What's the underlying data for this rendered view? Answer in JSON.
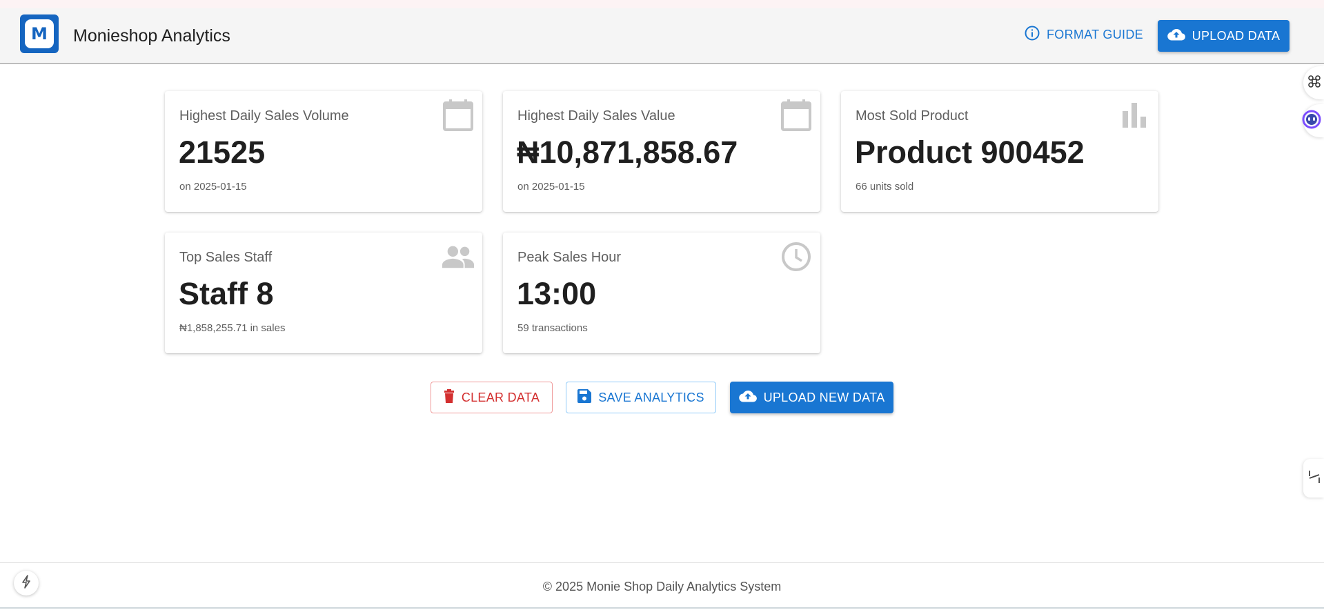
{
  "header": {
    "logo_letter": "M",
    "title": "Monieshop Analytics",
    "format_guide_label": "FORMAT GUIDE",
    "upload_label": "UPLOAD DATA"
  },
  "cards": [
    {
      "label": "Highest Daily Sales Volume",
      "value": "21525",
      "sub": "on 2025-01-15",
      "icon": "calendar-icon"
    },
    {
      "label": "Highest Daily Sales Value",
      "value": "₦10,871,858.67",
      "sub": "on 2025-01-15",
      "icon": "calendar-icon"
    },
    {
      "label": "Most Sold Product",
      "value": "Product 900452",
      "sub": "66 units sold",
      "icon": "bar-chart-icon"
    },
    {
      "label": "Top Sales Staff",
      "value": "Staff 8",
      "sub": "₦1,858,255.71 in sales",
      "icon": "people-icon"
    },
    {
      "label": "Peak Sales Hour",
      "value": "13:00",
      "sub": "59 transactions",
      "icon": "clock-icon"
    }
  ],
  "actions": {
    "clear_label": "CLEAR DATA",
    "save_label": "SAVE ANALYTICS",
    "upload_new_label": "UPLOAD NEW DATA"
  },
  "footer": {
    "text": "© 2025 Monie Shop Daily Analytics System"
  },
  "colors": {
    "primary": "#1976d2",
    "danger": "#d32f2f",
    "icon_gray": "#bdbdbd"
  },
  "icons": [
    "info-icon",
    "cloud-upload-icon",
    "trash-icon",
    "save-icon",
    "bolt-icon",
    "command-icon",
    "assistant-icon",
    "sidebar-toggle-icon"
  ]
}
